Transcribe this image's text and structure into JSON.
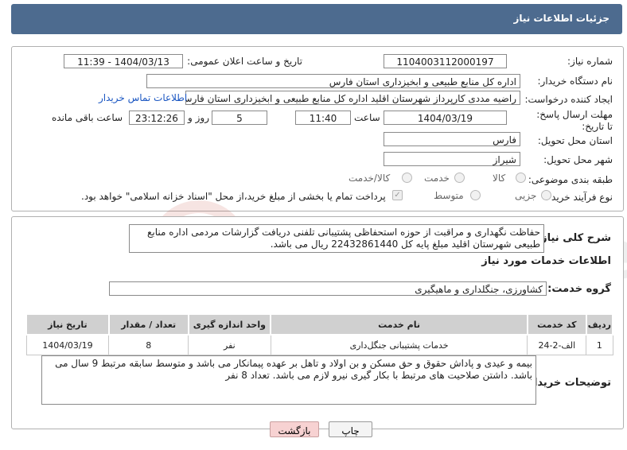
{
  "header": {
    "title": "جزئیات اطلاعات نیاز"
  },
  "form": {
    "need_number_label": "شماره نیاز:",
    "need_number": "1104003112000197",
    "announce_label": "تاریخ و ساعت اعلان عمومی:",
    "announce_value": "1404/03/13 - 11:39",
    "buyer_org_label": "نام دستگاه خریدار:",
    "buyer_org": "اداره کل منابع طبیعی و ابخیزداری استان فارس",
    "creator_label": "ایجاد کننده درخواست:",
    "creator": "راضیه مددی کارپرداز شهرستان اقلید اداره کل منابع طبیعی و ابخیزداری استان فارس",
    "contact_link": "اطلاعات تماس خریدار",
    "deadline_label": "مهلت ارسال پاسخ: تا تاریخ:",
    "deadline_date": "1404/03/19",
    "time_label": "ساعت",
    "deadline_time": "11:40",
    "days_value": "5",
    "days_label": "روز و",
    "remaining_time": "23:12:26",
    "remaining_label": "ساعت باقی مانده",
    "province_label": "استان محل تحویل:",
    "province": "فارس",
    "city_label": "شهر محل تحویل:",
    "city": "شیراز",
    "category_label": "طبقه بندی موضوعی:",
    "category_options": [
      "کالا",
      "خدمت",
      "کالا/خدمت"
    ],
    "process_label": "نوع فرآیند خرید :",
    "process_options": [
      "جزیی",
      "متوسط"
    ],
    "payment_note": "پرداخت تمام یا بخشی از مبلغ خرید،از محل \"اسناد خزانه اسلامی\" خواهد بود."
  },
  "summary": {
    "label": "شرح کلی نیاز:",
    "text": "حفاظت نگهداری و مراقبت از حوزه استحفاظی پشتیبانی تلفنی دریافت گزارشات مردمی اداره منابع طبیعی شهرستان اقلید مبلغ پایه کل 22432861440 ریال می باشد."
  },
  "services": {
    "section_title": "اطلاعات خدمات مورد نیاز",
    "group_label": "گروه خدمت:",
    "group_value": "کشاورزی، جنگلداری و ماهیگیری",
    "columns": [
      "ردیف",
      "کد خدمت",
      "نام خدمت",
      "واحد اندازه گیری",
      "تعداد / مقدار",
      "تاریخ نیاز"
    ],
    "rows": [
      [
        "1",
        "الف-2-24",
        "خدمات پشتیبانی جنگل‌داری",
        "نفر",
        "8",
        "1404/03/19"
      ]
    ]
  },
  "buyer_notes": {
    "label": "توضیحات خریدار:",
    "text": "بیمه و عیدی و پاداش  حقوق و حق مسکن و بن اولاد و تاهل بر عهده پیمانکار می باشد و متوسط سابقه مرتبط 9 سال می باشد. داشتن صلاحیت های مرتبط با بکار گیری نیرو لازم می باشد. تعداد 8 نفر"
  },
  "buttons": {
    "print": "چاپ",
    "back": "بازگشت"
  }
}
